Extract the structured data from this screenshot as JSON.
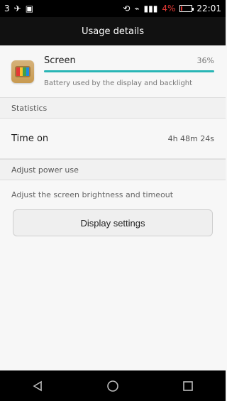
{
  "status": {
    "left_number": "3",
    "battery_percent": "4%",
    "time": "22:01"
  },
  "header": {
    "title": "Usage details"
  },
  "app": {
    "name": "Screen",
    "percent": "36%",
    "usage_fraction": 0.36,
    "description": "Battery used by the display and backlight",
    "colors": {
      "progress": "#29b6b6"
    }
  },
  "statistics": {
    "section_title": "Statistics",
    "time_on_label": "Time on",
    "time_on_value": "4h 48m 24s"
  },
  "adjust": {
    "section_title": "Adjust power use",
    "hint": "Adjust the screen brightness and timeout",
    "button_label": "Display settings"
  },
  "nav": {
    "back_icon": "back-icon",
    "home_icon": "home-icon",
    "recents_icon": "recents-icon"
  }
}
